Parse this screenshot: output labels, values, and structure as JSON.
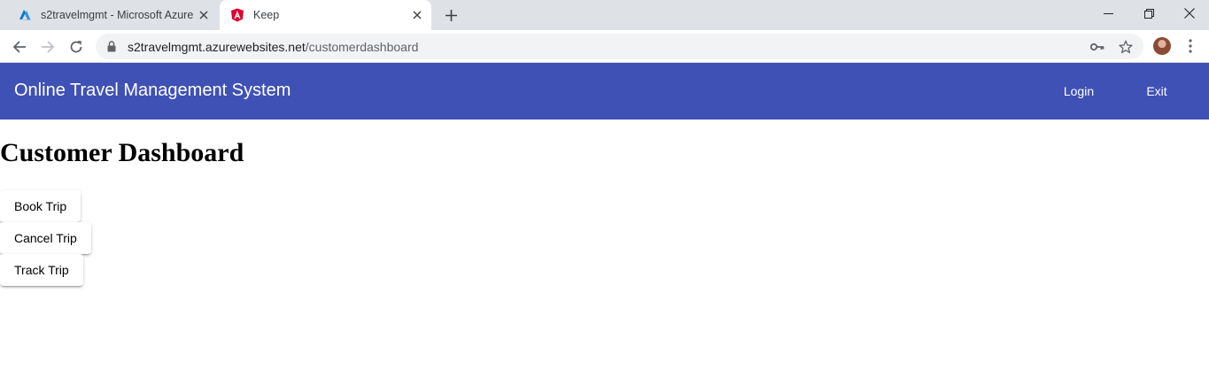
{
  "browser": {
    "tabs": [
      {
        "title": "s2travelmgmt - Microsoft Azure",
        "favicon": "azure-logo-icon",
        "active": false
      },
      {
        "title": "Keep",
        "favicon": "angular-logo-icon",
        "active": true
      }
    ],
    "url_host": "s2travelmgmt.azurewebsites.net",
    "url_path": "/customerdashboard"
  },
  "app": {
    "title": "Online Travel Management System",
    "nav": {
      "login_label": "Login",
      "exit_label": "Exit"
    }
  },
  "page": {
    "heading": "Customer Dashboard",
    "actions": [
      {
        "label": "Book Trip"
      },
      {
        "label": "Cancel Trip"
      },
      {
        "label": "Track Trip"
      }
    ]
  },
  "colors": {
    "header_bg": "#3f51b5",
    "tabstrip_bg": "#dee1e6",
    "omnibox_bg": "#f1f3f4",
    "azure_blue": "#0078d4",
    "angular_red": "#dd0031"
  }
}
